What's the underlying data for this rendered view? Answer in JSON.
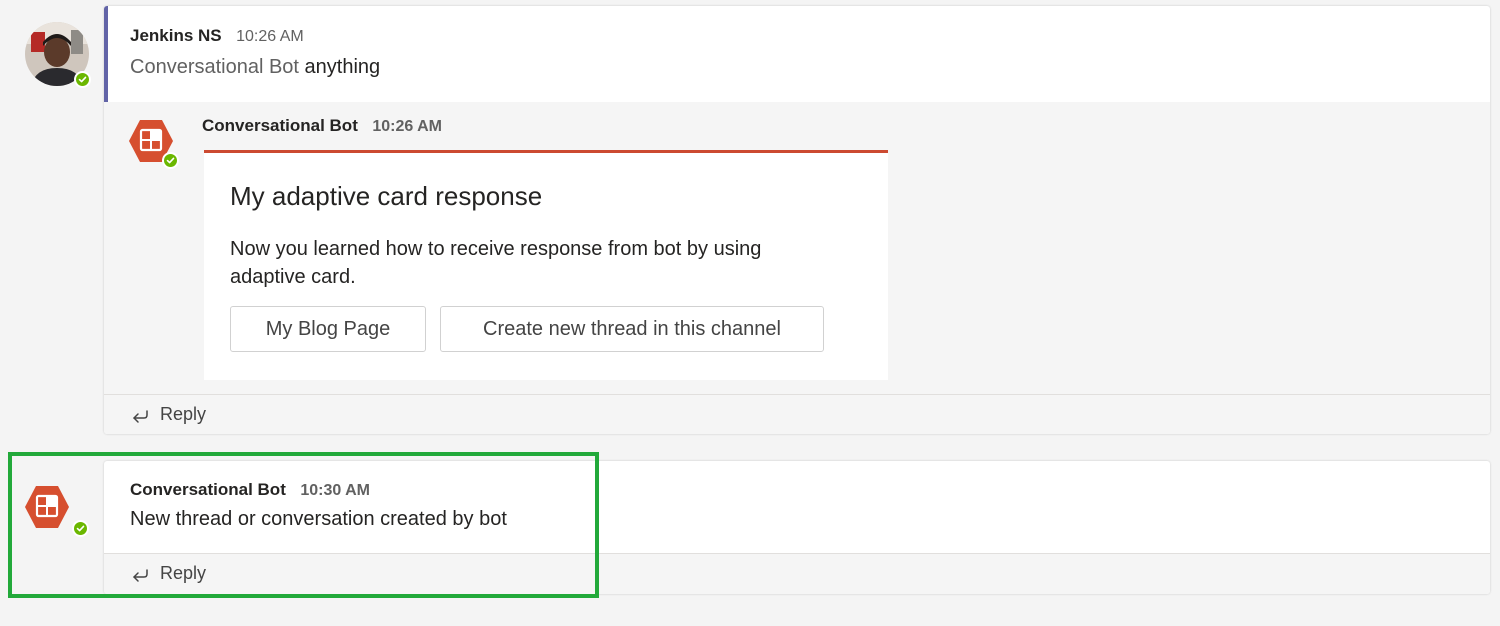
{
  "thread1": {
    "author": "Jenkins NS",
    "time": "10:26 AM",
    "mention": "Conversational Bot",
    "text": " anything",
    "reply": {
      "author": "Conversational Bot",
      "time": "10:26 AM",
      "card": {
        "title": "My adaptive card response",
        "text": "Now you learned how to receive response from bot by using adaptive card.",
        "buttons": [
          "My Blog Page",
          "Create new thread in this channel"
        ]
      }
    },
    "reply_label": "Reply"
  },
  "thread2": {
    "author": "Conversational Bot",
    "time": "10:30 AM",
    "text": "New thread or conversation created by bot",
    "reply_label": "Reply"
  },
  "colors": {
    "bot_avatar": "#d64f2f",
    "card_accent": "#cc4a31",
    "presence": "#6bb700",
    "thread_bar": "#6264a7",
    "highlight": "#22a93a"
  }
}
